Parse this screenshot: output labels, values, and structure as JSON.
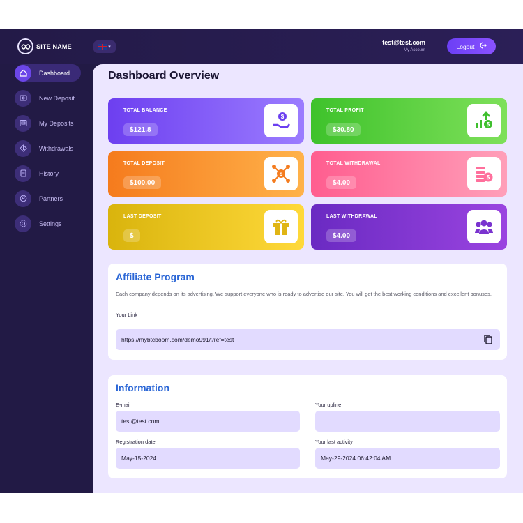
{
  "header": {
    "site_name": "SITE NAME",
    "account_email": "test@test.com",
    "account_sub": "My Account",
    "logout_label": "Logout"
  },
  "sidebar": {
    "items": [
      {
        "label": "Dashboard",
        "icon": "home-icon",
        "active": true
      },
      {
        "label": "New Deposit",
        "icon": "deposit-icon",
        "active": false
      },
      {
        "label": "My Deposits",
        "icon": "wallet-icon",
        "active": false
      },
      {
        "label": "Withdrawals",
        "icon": "withdraw-icon",
        "active": false
      },
      {
        "label": "History",
        "icon": "history-icon",
        "active": false
      },
      {
        "label": "Partners",
        "icon": "partners-icon",
        "active": false
      },
      {
        "label": "Settings",
        "icon": "gear-icon",
        "active": false
      }
    ]
  },
  "main": {
    "title": "Dashboard Overview",
    "cards": [
      {
        "label": "TOTAL BALANCE",
        "value": "$121.8",
        "icon": "money-hand-icon",
        "color": "#7a4ff5"
      },
      {
        "label": "TOTAL PROFIT",
        "value": "$30.80",
        "icon": "growth-chart-icon",
        "color": "#4fcf36"
      },
      {
        "label": "TOTAL DEPOSIT",
        "value": "$100.00",
        "icon": "network-dollar-icon",
        "color": "#f98b29"
      },
      {
        "label": "TOTAL WITHDRAWAL",
        "value": "$4.00",
        "icon": "coins-stack-icon",
        "color": "#ff6f9c"
      },
      {
        "label": "LAST DEPOSIT",
        "value": "$",
        "icon": "gift-icon",
        "color": "#e3bd16"
      },
      {
        "label": "LAST WITHDRAWAL",
        "value": "$4.00",
        "icon": "users-icon",
        "color": "#7a33cf"
      }
    ],
    "affiliate": {
      "title": "Affiliate Program",
      "text": "Each company depends on its advertising. We support everyone who is ready to advertise our site. You will get the best working conditions and excellent bonuses.",
      "link_label": "Your Link",
      "link_value": "https://mybtcboom.com/demo991/?ref=test"
    },
    "information": {
      "title": "Information",
      "email_label": "E-mail",
      "email_value": "test@test.com",
      "upline_label": "Your upline",
      "upline_value": "",
      "reg_label": "Registration date",
      "reg_value": "May-15-2024",
      "activity_label": "Your last activity",
      "activity_value": "May-29-2024 06:42:04 AM"
    }
  }
}
